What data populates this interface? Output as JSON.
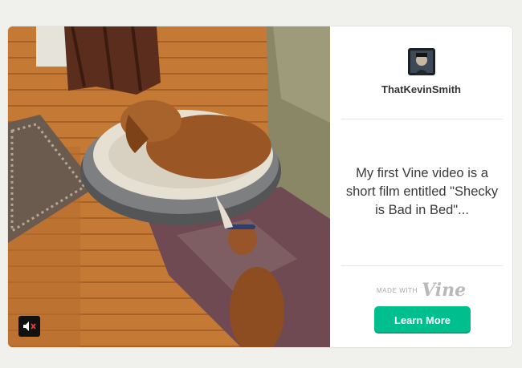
{
  "video": {
    "mute_icon": "speaker-muted-icon"
  },
  "author": {
    "avatar_icon": "user-avatar",
    "username": "ThatKevinSmith"
  },
  "post": {
    "caption": "My first Vine video is a short film entitled \"Shecky is Bad in Bed\"..."
  },
  "branding": {
    "made_with": "MADE WITH",
    "logo_text": "Vine",
    "cta_label": "Learn More"
  },
  "colors": {
    "page_background": "#f0f0ec",
    "cta_green": "#00bf8f",
    "text_dark": "#333333"
  }
}
